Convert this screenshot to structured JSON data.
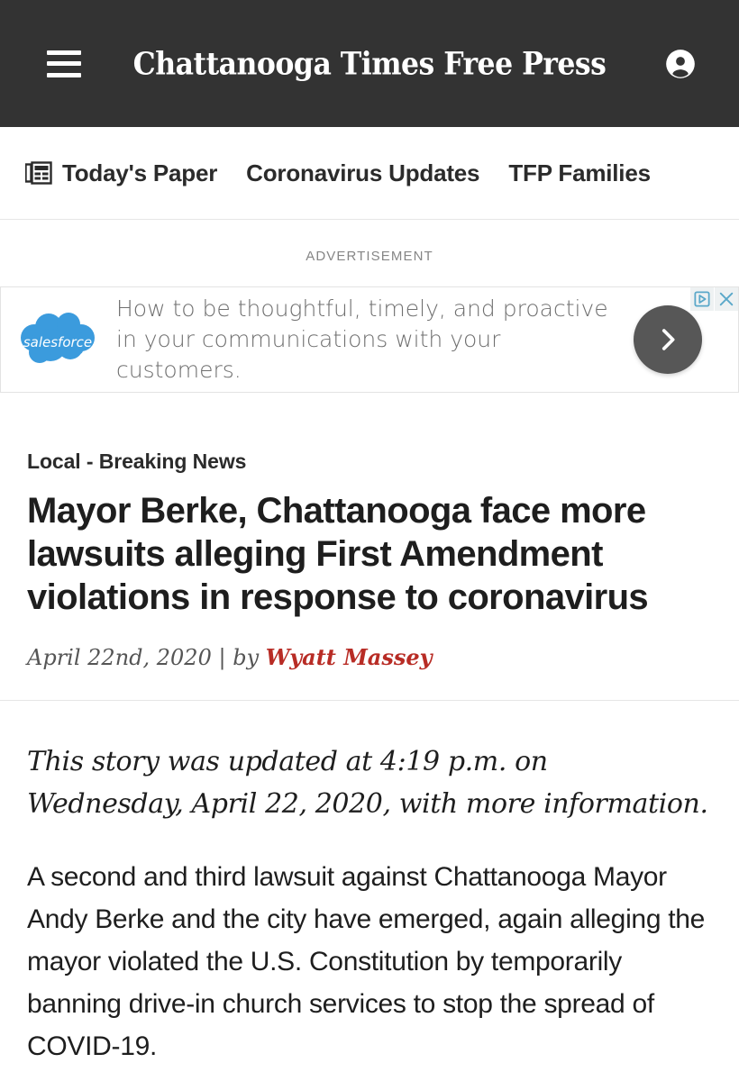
{
  "header": {
    "masthead": "Chattanooga Times Free Press",
    "menu_icon": "hamburger-menu-icon",
    "account_icon": "account-avatar-icon",
    "background": "#333333"
  },
  "section_nav": {
    "paper_icon": "newspaper-icon",
    "items": [
      {
        "label": "Today's Paper",
        "has_icon": true
      },
      {
        "label": "Coronavirus Updates",
        "has_icon": false
      },
      {
        "label": "TFP Families",
        "has_icon": false
      }
    ]
  },
  "advertisement": {
    "label": "ADVERTISEMENT",
    "brand": "salesforce",
    "brand_color": "#3b9bdd",
    "copy_line1": "How to be thoughtful, timely, and proactive",
    "copy_line2": "in your communications with your",
    "copy_line3": "customers.",
    "cta_icon": "chevron-right-icon",
    "cta_color": "#575757",
    "adchoices_icon": "adchoices-icon",
    "close_icon": "close-icon",
    "badge_color": "#5ba8c9"
  },
  "article": {
    "kicker": "Local - Breaking News",
    "headline": "Mayor Berke, Chattanooga face more lawsuits alleging First Amendment violations in response to coronavirus",
    "date": "April 22nd, 2020",
    "separator": "|",
    "by_label": "by",
    "author": "Wyatt Massey",
    "author_color": "#b82c25",
    "editors_note": "This story was updated at 4:19 p.m. on Wednesday, April 22, 2020, with more information.",
    "paragraph_1": "A second and third lawsuit against Chattanooga Mayor Andy Berke and the city have emerged, again alleging the mayor violated the U.S. Constitution by temporarily banning drive-in church services to stop the spread of COVID-19."
  }
}
